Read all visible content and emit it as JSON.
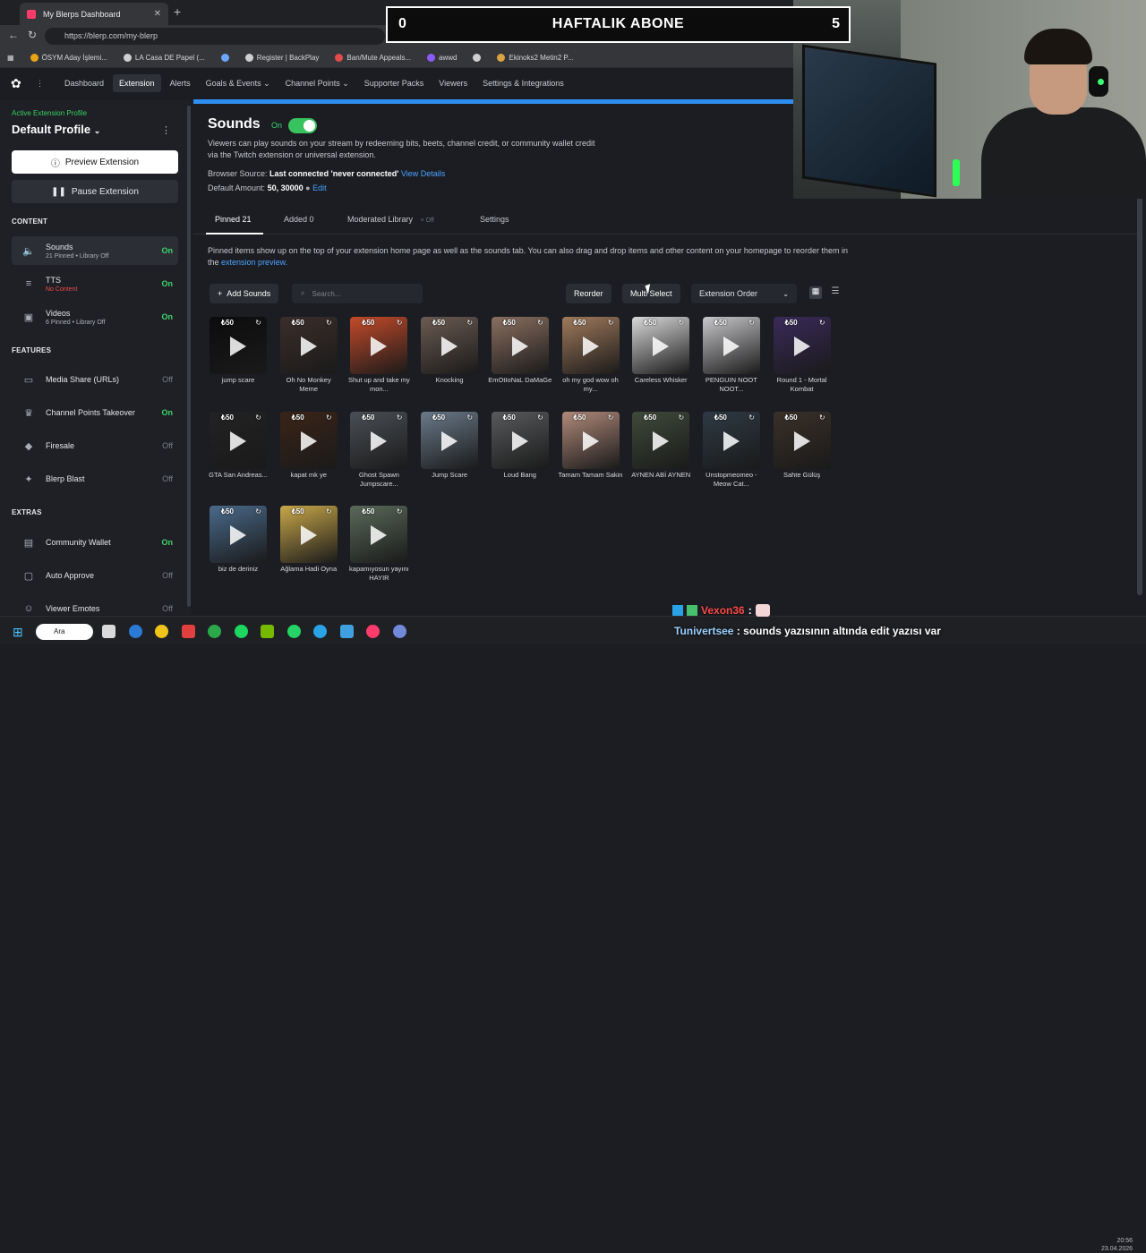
{
  "browser": {
    "tab_title": "My Blerps Dashboard",
    "url": "https://blerp.com/my-blerp",
    "bookmarks": [
      {
        "label": "ÖSYM Aday İşlemi...",
        "color": "#e8a317",
        "icon": "osym-icon"
      },
      {
        "label": "LA Casa DE Papel (...",
        "color": "#cfcfcf",
        "icon": "globe-icon"
      },
      {
        "label": "",
        "color": "#6aa6ff",
        "icon": "shield-icon"
      },
      {
        "label": "Register | BackPlay",
        "color": "#cfcfcf",
        "icon": "doc-icon"
      },
      {
        "label": "Ban/Mute Appeals...",
        "color": "#e14b4b",
        "icon": "ban-icon"
      },
      {
        "label": "awwd",
        "color": "#8a5cf6",
        "icon": "v-icon"
      },
      {
        "label": "",
        "color": "#cfcfcf",
        "icon": "list-icon"
      },
      {
        "label": "Ekinoks2 Metin2 P...",
        "color": "#d9a441",
        "icon": "game-icon"
      }
    ]
  },
  "nav": {
    "items": [
      "Dashboard",
      "Extension",
      "Alerts",
      "Goals & Events",
      "Channel Points",
      "Supporter Packs",
      "Viewers",
      "Settings & Integrations"
    ],
    "active": "Extension"
  },
  "sidebar": {
    "profile_label": "Active Extension Profile",
    "profile_name": "Default Profile",
    "preview_btn": "Preview Extension",
    "pause_btn": "Pause Extension",
    "content_title": "CONTENT",
    "features_title": "FEATURES",
    "extras_title": "EXTRAS",
    "content": [
      {
        "name": "Sounds",
        "sub": "21 Pinned • Library Off",
        "status": "On",
        "active": true
      },
      {
        "name": "TTS",
        "sub": "No Content",
        "status": "On",
        "sub_red": true
      },
      {
        "name": "Videos",
        "sub": "6 Pinned • Library Off",
        "status": "On"
      }
    ],
    "features": [
      {
        "name": "Media Share (URLs)",
        "status": "Off"
      },
      {
        "name": "Channel Points Takeover",
        "status": "On"
      },
      {
        "name": "Firesale",
        "status": "Off"
      },
      {
        "name": "Blerp Blast",
        "status": "Off"
      }
    ],
    "extras": [
      {
        "name": "Community Wallet",
        "status": "On"
      },
      {
        "name": "Auto Approve",
        "status": "Off"
      },
      {
        "name": "Viewer Emotes",
        "status": "Off"
      }
    ]
  },
  "main": {
    "title": "Sounds",
    "on_label": "On",
    "description": "Viewers can play sounds on your stream by redeeming bits, beets, channel credit, or community wallet credit via the Twitch extension or universal extension.",
    "browser_source_label": "Browser Source:",
    "browser_source_value": "Last connected 'never connected'",
    "view_details": "View Details",
    "default_amount_label": "Default Amount:",
    "default_amount_value": "50, 30000",
    "edit": "Edit",
    "tabs": {
      "pinned": "Pinned 21",
      "added": "Added 0",
      "moderated": "Moderated Library",
      "moderated_state": "Off",
      "settings": "Settings"
    },
    "info_text": "Pinned items show up on the top of your extension home page as well as the sounds tab. You can also drag and drop items and other content on your homepage to reorder them in the",
    "info_link": "extension preview.",
    "add_sounds": "Add Sounds",
    "search_placeholder": "Search...",
    "reorder": "Reorder",
    "multi_select": "Multi Select",
    "sort_value": "Extension Order"
  },
  "sounds": [
    {
      "price": "50",
      "title": "jump scare",
      "bg": "#0c0c0c"
    },
    {
      "price": "50",
      "title": "Oh No Monkey Meme",
      "bg": "#3b2e2a"
    },
    {
      "price": "50",
      "title": "Shut up and take my mon...",
      "bg": "#c34a2a"
    },
    {
      "price": "50",
      "title": "Knocking",
      "bg": "#6b5b52"
    },
    {
      "price": "50",
      "title": "EmOtIoNaL DaMaGe",
      "bg": "#8a6f60"
    },
    {
      "price": "50",
      "title": "oh my god wow oh my...",
      "bg": "#a07a5c"
    },
    {
      "price": "50",
      "title": "Careless Whisker",
      "bg": "#d8d8d8"
    },
    {
      "price": "50",
      "title": "PENGUIN NOOT NOOT...",
      "bg": "#c8c8cc"
    },
    {
      "price": "50",
      "title": "Round 1 - Mortal Kombat",
      "bg": "#3a2a5a"
    },
    {
      "price": "50",
      "title": "GTA San Andreas...",
      "bg": "#222222"
    },
    {
      "price": "50",
      "title": "kapat mk ye",
      "bg": "#3a2418"
    },
    {
      "price": "50",
      "title": "Ghost Spawn Jumpscare...",
      "bg": "#4a4f55"
    },
    {
      "price": "50",
      "title": "Jump Scare",
      "bg": "#6a7a8a"
    },
    {
      "price": "50",
      "title": "Loud Bang",
      "bg": "#585a5c"
    },
    {
      "price": "50",
      "title": "Tamam Tamam Sakin",
      "bg": "#b08a7a"
    },
    {
      "price": "50",
      "title": "AYNEN ABİ AYNEN",
      "bg": "#3f4a3a"
    },
    {
      "price": "50",
      "title": "Unstopmeomeo - Meow Cat...",
      "bg": "#2e3a44"
    },
    {
      "price": "50",
      "title": "Sahte Gülüş",
      "bg": "#3a3028"
    },
    {
      "price": "50",
      "title": "biz de deriniz",
      "bg": "#4a6a8a"
    },
    {
      "price": "50",
      "title": "Ağlama Hadi Oyna",
      "bg": "#c9a84a"
    },
    {
      "price": "50",
      "title": "kapamıyosun yayını HAYIR",
      "bg": "#5a6a5a"
    }
  ],
  "overlay": {
    "left_count": "0",
    "title": "HAFTALIK ABONE",
    "right_count": "5"
  },
  "chat": {
    "line1_user": "Vexon36",
    "line2_user": "Tunivertsee",
    "line2_text": "sounds yazısının altında edit yazısı var"
  },
  "taskbar": {
    "search": "Ara",
    "clock_time": "20:56",
    "clock_date": "23.04.2026"
  }
}
